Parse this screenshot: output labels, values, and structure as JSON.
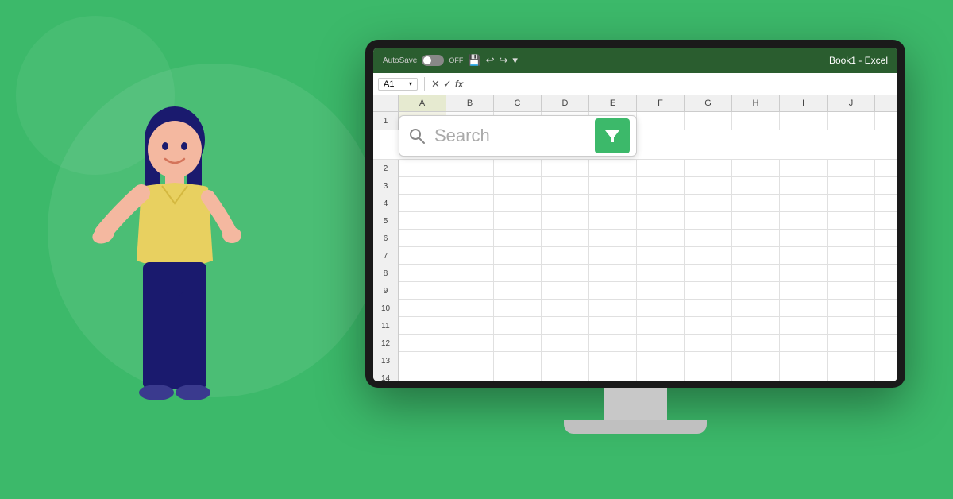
{
  "background": {
    "color": "#3cb96a"
  },
  "titlebar": {
    "autosave_label": "AutoSave",
    "toggle_state": "OFF",
    "title": "Book1 - Excel",
    "toolbar_icons": [
      "💾",
      "↩",
      "↪",
      "▾"
    ]
  },
  "formulabar": {
    "cell_ref": "A1",
    "formula_content": ""
  },
  "columns": [
    "A",
    "B",
    "C",
    "D",
    "E",
    "F",
    "G",
    "H",
    "I",
    "J"
  ],
  "rows": [
    1,
    2,
    3,
    4,
    5,
    6,
    7,
    8,
    9,
    10,
    11,
    12,
    13,
    14
  ],
  "search": {
    "placeholder": "Search",
    "filter_icon": "▼"
  }
}
